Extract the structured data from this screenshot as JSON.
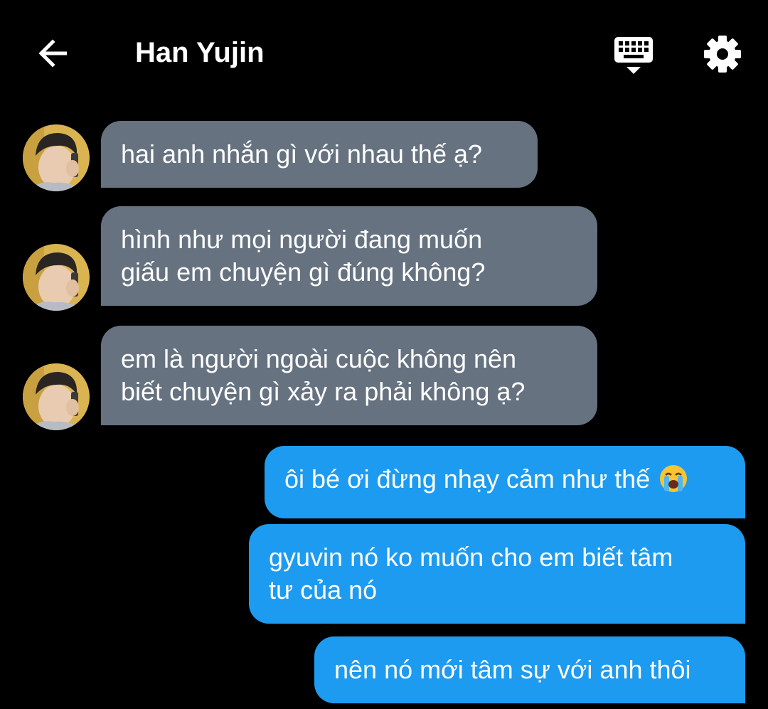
{
  "header": {
    "title": "Han Yujin",
    "back_icon": "arrow-left-icon",
    "keyboard_icon": "keyboard-icon",
    "settings_icon": "gear-icon"
  },
  "colors": {
    "background": "#000000",
    "incoming_bubble": "#667280",
    "outgoing_bubble": "#1d9bf0",
    "text": "#ffffff"
  },
  "messages": [
    {
      "direction": "incoming",
      "lines": [
        "hai anh nhắn gì với nhau thế ạ?"
      ]
    },
    {
      "direction": "incoming",
      "lines": [
        "hình như mọi người đang muốn",
        "giấu em chuyện gì đúng không?"
      ]
    },
    {
      "direction": "incoming",
      "lines": [
        "em là người ngoài cuộc không nên",
        "biết chuyện gì xảy ra phải không ạ?"
      ]
    },
    {
      "direction": "outgoing",
      "lines": [
        "ôi bé ơi đừng nhạy cảm như thế"
      ],
      "emoji": "loudly-crying-face-icon"
    },
    {
      "direction": "outgoing",
      "lines": [
        "gyuvin nó ko muốn cho em biết tâm",
        "tư của nó"
      ]
    },
    {
      "direction": "outgoing",
      "lines": [
        "nên nó mới tâm sự với anh thôi"
      ]
    }
  ]
}
